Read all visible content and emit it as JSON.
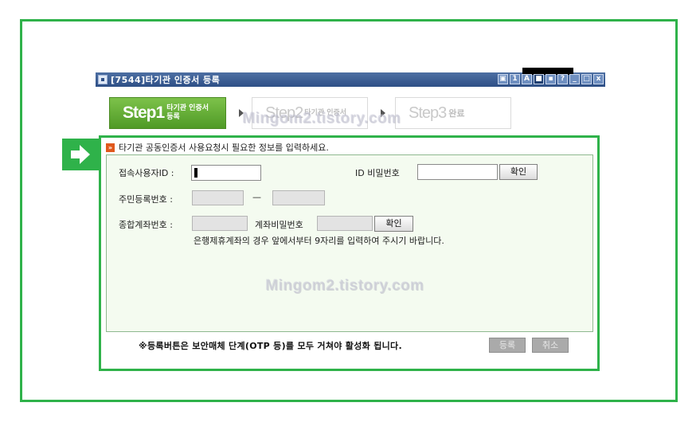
{
  "window": {
    "title": "[7544]타기관 인증서 등록",
    "buttons": [
      "▣",
      "1",
      "A",
      "■",
      "▪",
      "?",
      "_",
      "□",
      "x"
    ]
  },
  "steps": [
    {
      "big": "Step1",
      "small_line1": "타기관 인증서",
      "small_line2": "등록",
      "state": "active"
    },
    {
      "big": "Step2",
      "small_line1": "타기관 인증서",
      "small_line2": "",
      "state": "inactive"
    },
    {
      "big": "Step3",
      "small_line1": "완료",
      "small_line2": "",
      "state": "inactive"
    }
  ],
  "watermark": "Mingom2.tistory.com",
  "form": {
    "instruction": "타기관 공동인증서 사용요청시 필요한 정보를 입력하세요.",
    "user_id_label": "접속사용자ID :",
    "id_password_label": "ID 비밀번호",
    "confirm_label": "확인",
    "resident_no_label": "주민등록번호 :",
    "resident_separator": "—",
    "account_no_label": "종합계좌번호 :",
    "account_password_label": "계좌비밀번호",
    "account_hint": "은행제휴계좌의 경우 앞에서부터 9자리를 입력하여 주시기 바랍니다."
  },
  "footer": {
    "notice": "※등록버튼은 보안매체 단계(OTP 등)를 모두 거쳐야 활성화 됩니다.",
    "register_label": "등록",
    "cancel_label": "취소"
  },
  "colors": {
    "highlight_green": "#2fb24a",
    "titlebar_blue": "#2e4f86",
    "step_active_green": "#5ea62f"
  }
}
